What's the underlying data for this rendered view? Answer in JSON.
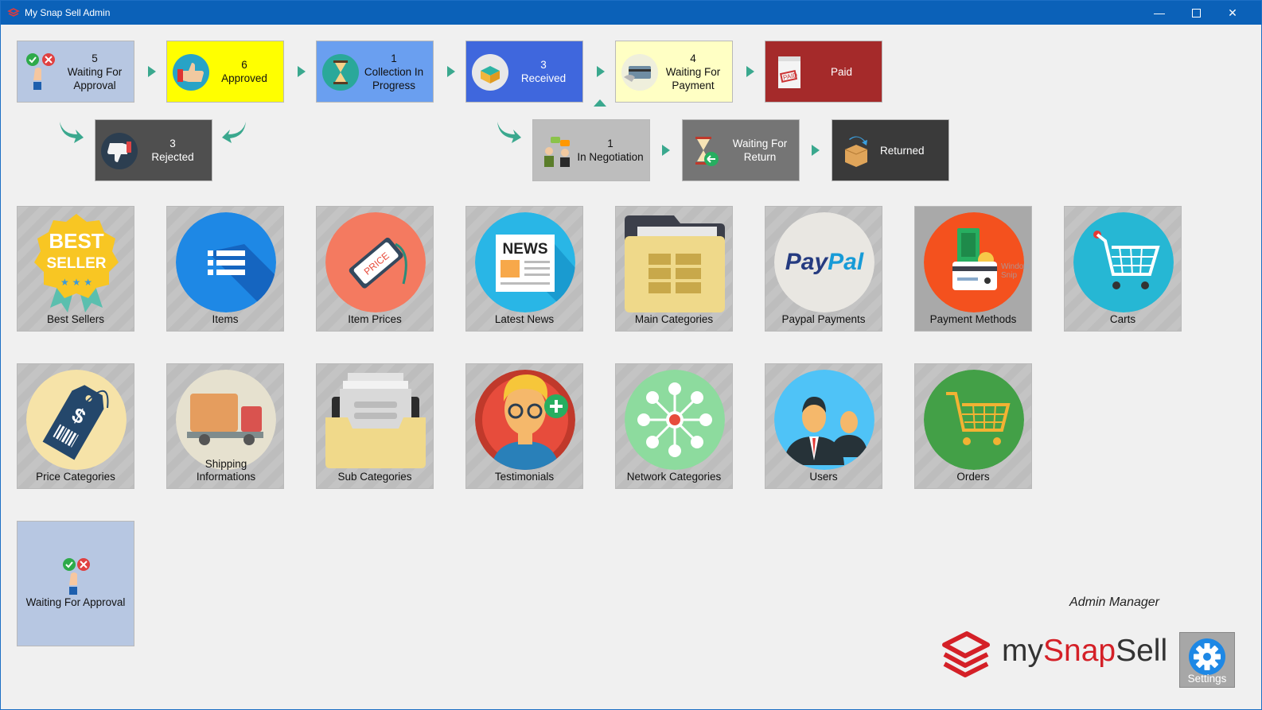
{
  "window": {
    "title": "My Snap Sell Admin"
  },
  "workflow": {
    "top": [
      {
        "count": "5",
        "label": "Waiting For Approval",
        "bg": "#b7c7e2",
        "color": "#111111"
      },
      {
        "count": "6",
        "label": "Approved",
        "bg": "#ffff00",
        "color": "#111111"
      },
      {
        "count": "1",
        "label": "Collection In Progress",
        "bg": "#6a9ff0",
        "color": "#111111"
      },
      {
        "count": "3",
        "label": "Received",
        "bg": "#3f67dd",
        "color": "#ffffff"
      },
      {
        "count": "4",
        "label": "Waiting For Payment",
        "bg": "#ffffc4",
        "color": "#111111"
      },
      {
        "count": "",
        "label": "Paid",
        "bg": "#a52a2a",
        "color": "#ffffff"
      }
    ],
    "rejected": {
      "count": "3",
      "label": "Rejected",
      "bg": "#4f4f4f",
      "color": "#ffffff"
    },
    "bottom": [
      {
        "count": "1",
        "label": "In Negotiation",
        "bg": "#bdbdbd",
        "color": "#111111"
      },
      {
        "count": "",
        "label": "Waiting For Return",
        "bg": "#757575",
        "color": "#ffffff"
      },
      {
        "count": "",
        "label": "Returned",
        "bg": "#3a3a3a",
        "color": "#ffffff"
      }
    ]
  },
  "menu": {
    "row1": [
      {
        "label": "Best Sellers",
        "icon": "best-seller-badge-icon"
      },
      {
        "label": "Items",
        "icon": "list-icon"
      },
      {
        "label": "Item Prices",
        "icon": "price-tag-icon"
      },
      {
        "label": "Latest News",
        "icon": "newspaper-icon"
      },
      {
        "label": "Main Categories",
        "icon": "folder-icon"
      },
      {
        "label": "Paypal Payments",
        "icon": "paypal-icon"
      },
      {
        "label": "Payment Methods",
        "icon": "credit-card-icon",
        "overlay": "Window Snip"
      },
      {
        "label": "Carts",
        "icon": "cart-icon"
      }
    ],
    "row2": [
      {
        "label": "Price Categories",
        "icon": "dollar-tag-icon"
      },
      {
        "label": "Shipping Informations",
        "icon": "truck-icon"
      },
      {
        "label": "Sub Categories",
        "icon": "file-tray-icon"
      },
      {
        "label": "Testimonials",
        "icon": "person-add-icon"
      },
      {
        "label": "Network Categories",
        "icon": "network-icon"
      },
      {
        "label": "Users",
        "icon": "users-icon"
      },
      {
        "label": "Orders",
        "icon": "shopping-cart-icon"
      }
    ],
    "row3": [
      {
        "label": "Waiting For Approval",
        "icon": "approval-icon"
      }
    ]
  },
  "footer": {
    "admin_label": "Admin Manager",
    "logo_text_1": "my",
    "logo_text_2": "Snap",
    "logo_text_3": "Sell",
    "settings_label": "Settings"
  },
  "colors": {
    "accent": "#0b61b8",
    "arrow": "#3aa88e",
    "tile_gray": "#bdbdbd",
    "brand_red": "#d42027"
  }
}
